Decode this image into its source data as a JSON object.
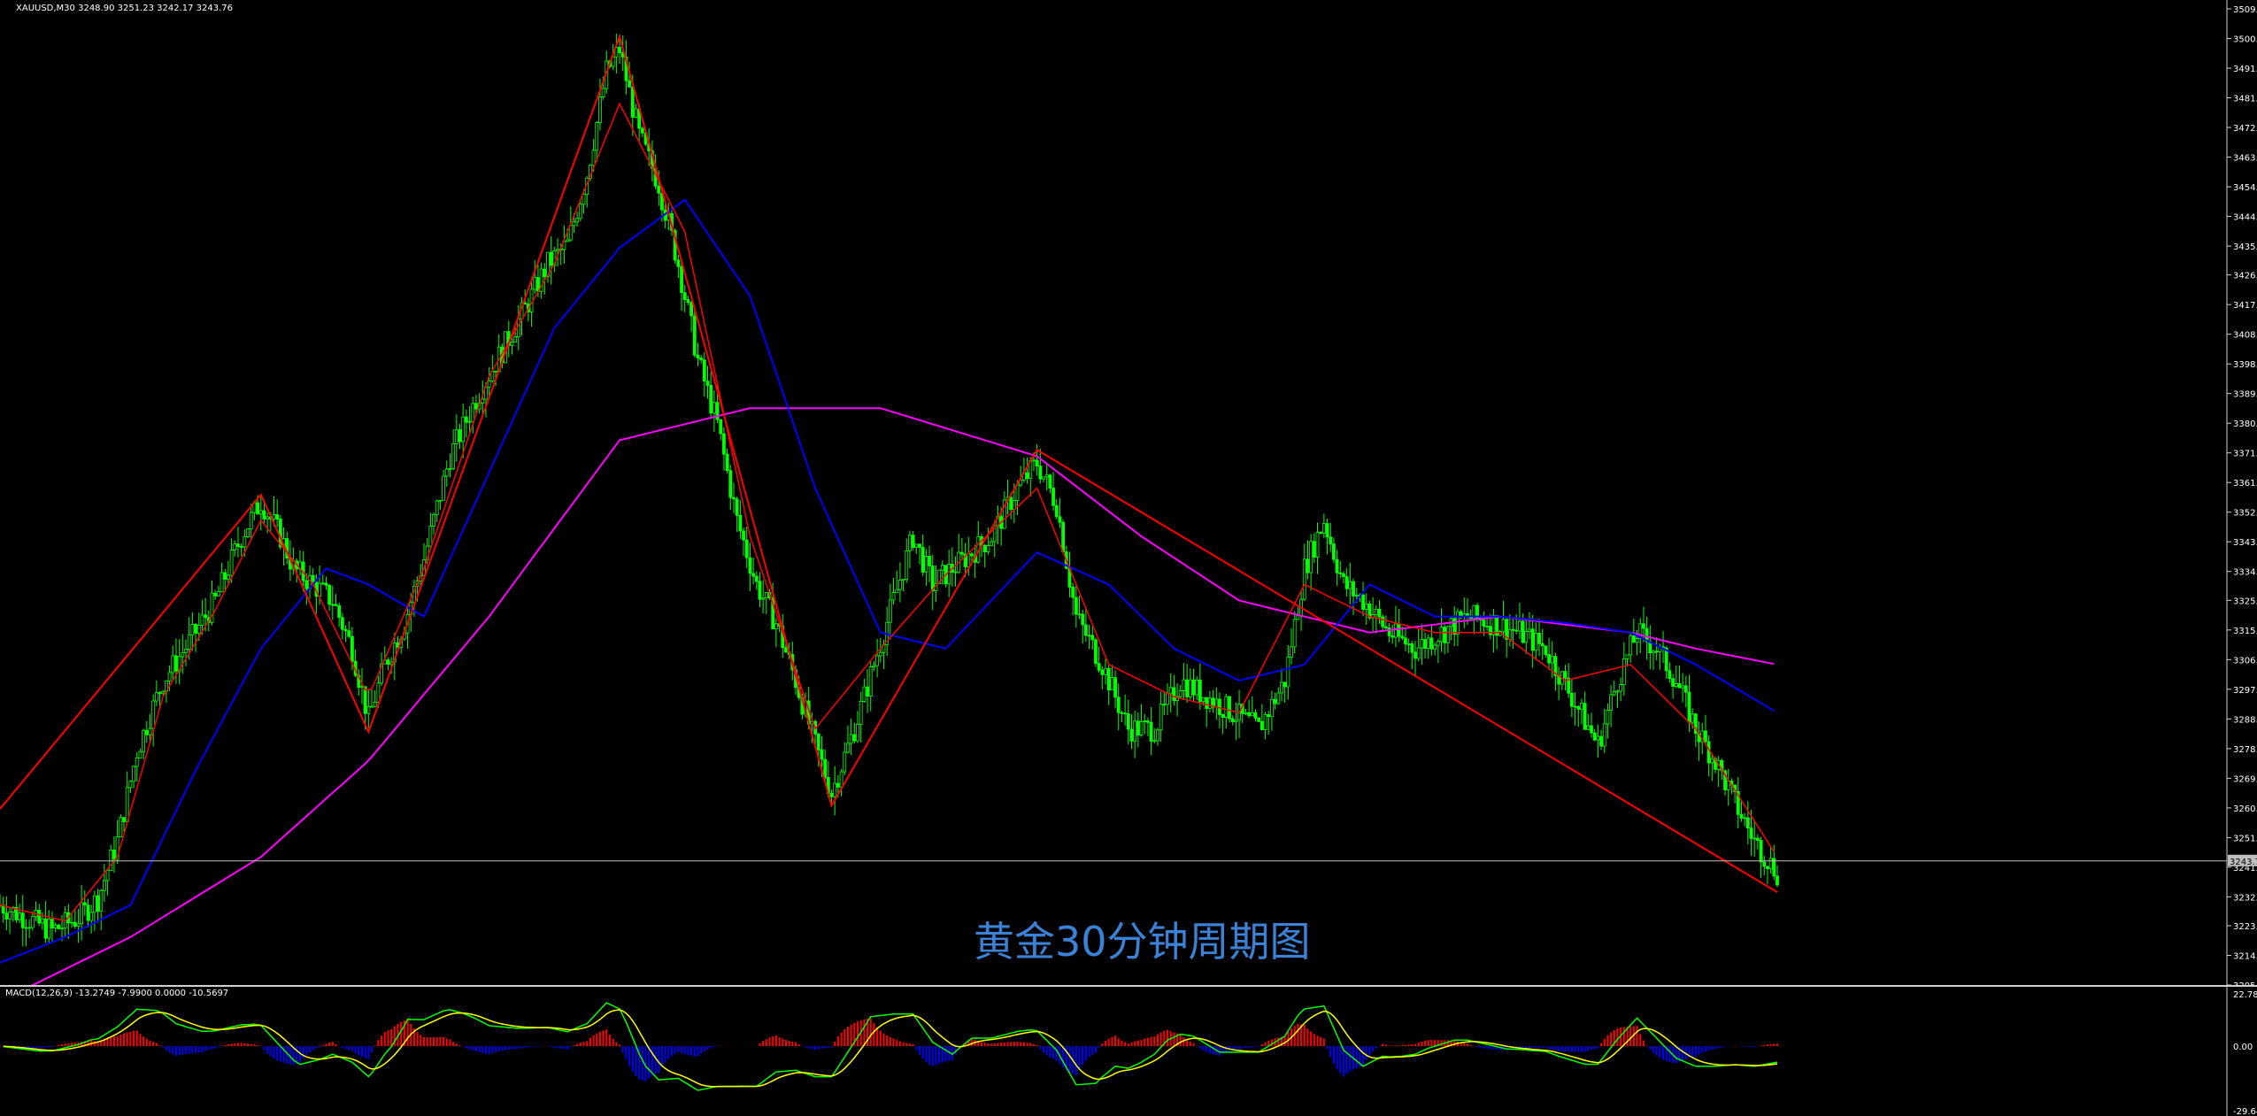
{
  "header": {
    "symbol_info": "XAUUSD,M30  3248.90 3251.23 3242.17 3243.76",
    "macd_info": "MACD(12,26,9) -13.2749 -7.9900 0.0000 -10.5697"
  },
  "watermark": "黄金30分钟周期图",
  "colors": {
    "background": "#000000",
    "bull_candle": "#00ff00",
    "bear_candle": "#00ff00",
    "ma_fast": "#ff0000",
    "ma_mid": "#0000ff",
    "ma_slow": "#ff00ff",
    "zigzag": "#ff0000",
    "macd_pos": "#ff0000",
    "macd_neg": "#0000ff",
    "macd_line": "#ffff00",
    "macd_signal": "#00ff00",
    "axis_text": "#ffffff",
    "watermark": "#3b82d6"
  },
  "chart_data": [
    {
      "type": "candlestick",
      "symbol": "XAUUSD",
      "timeframe": "M30",
      "ylim": [
        3205.05,
        3509.55
      ],
      "y_tick_labels": [
        "3509.55",
        "3500.30",
        "3491.05",
        "3481.80",
        "3472.55",
        "3463.30",
        "3454.05",
        "3444.80",
        "3435.55",
        "3426.55",
        "3417.30",
        "3408.05",
        "3398.80",
        "3389.55",
        "3380.30",
        "3371.05",
        "3361.80",
        "3352.55",
        "3343.30",
        "3334.05",
        "3325.05",
        "3315.80",
        "3306.55",
        "3297.30",
        "3288.05",
        "3278.80",
        "3269.55",
        "3260.30",
        "3251.05",
        "3241.80",
        "3232.55",
        "3223.55",
        "3214.30",
        "3205.05"
      ],
      "current_price": "3243.76",
      "zigzag_points": [
        {
          "bar": 0,
          "price": 3260
        },
        {
          "bar": 80,
          "price": 3358
        },
        {
          "bar": 113,
          "price": 3284
        },
        {
          "bar": 190,
          "price": 3501
        },
        {
          "bar": 255,
          "price": 3261
        },
        {
          "bar": 318,
          "price": 3372
        },
        {
          "bar": 545,
          "price": 3234
        }
      ],
      "price_path": [
        [
          0,
          3230
        ],
        [
          8,
          3226
        ],
        [
          16,
          3222
        ],
        [
          24,
          3226
        ],
        [
          30,
          3232
        ],
        [
          36,
          3250
        ],
        [
          42,
          3278
        ],
        [
          50,
          3300
        ],
        [
          58,
          3312
        ],
        [
          66,
          3325
        ],
        [
          74,
          3345
        ],
        [
          80,
          3356
        ],
        [
          86,
          3345
        ],
        [
          90,
          3335
        ],
        [
          96,
          3330
        ],
        [
          102,
          3325
        ],
        [
          108,
          3310
        ],
        [
          113,
          3288
        ],
        [
          118,
          3305
        ],
        [
          124,
          3318
        ],
        [
          130,
          3338
        ],
        [
          138,
          3370
        ],
        [
          146,
          3388
        ],
        [
          154,
          3403
        ],
        [
          162,
          3418
        ],
        [
          168,
          3430
        ],
        [
          174,
          3436
        ],
        [
          180,
          3458
        ],
        [
          186,
          3490
        ],
        [
          190,
          3497
        ],
        [
          196,
          3470
        ],
        [
          202,
          3455
        ],
        [
          208,
          3430
        ],
        [
          214,
          3400
        ],
        [
          220,
          3380
        ],
        [
          226,
          3350
        ],
        [
          232,
          3330
        ],
        [
          238,
          3318
        ],
        [
          244,
          3300
        ],
        [
          250,
          3280
        ],
        [
          255,
          3265
        ],
        [
          262,
          3285
        ],
        [
          268,
          3305
        ],
        [
          274,
          3325
        ],
        [
          280,
          3345
        ],
        [
          286,
          3330
        ],
        [
          292,
          3335
        ],
        [
          298,
          3340
        ],
        [
          304,
          3345
        ],
        [
          312,
          3360
        ],
        [
          318,
          3368
        ],
        [
          324,
          3355
        ],
        [
          330,
          3320
        ],
        [
          338,
          3305
        ],
        [
          346,
          3285
        ],
        [
          354,
          3285
        ],
        [
          362,
          3300
        ],
        [
          370,
          3295
        ],
        [
          378,
          3290
        ],
        [
          386,
          3285
        ],
        [
          394,
          3300
        ],
        [
          400,
          3335
        ],
        [
          406,
          3350
        ],
        [
          412,
          3330
        ],
        [
          418,
          3325
        ],
        [
          426,
          3315
        ],
        [
          434,
          3310
        ],
        [
          442,
          3315
        ],
        [
          450,
          3320
        ],
        [
          458,
          3318
        ],
        [
          466,
          3315
        ],
        [
          474,
          3310
        ],
        [
          482,
          3295
        ],
        [
          490,
          3280
        ],
        [
          496,
          3300
        ],
        [
          502,
          3315
        ],
        [
          508,
          3310
        ],
        [
          514,
          3300
        ],
        [
          520,
          3285
        ],
        [
          526,
          3275
        ],
        [
          532,
          3262
        ],
        [
          538,
          3250
        ],
        [
          545,
          3240
        ]
      ],
      "ma_fast_path": [
        [
          0,
          3230
        ],
        [
          20,
          3225
        ],
        [
          36,
          3245
        ],
        [
          50,
          3295
        ],
        [
          66,
          3322
        ],
        [
          80,
          3350
        ],
        [
          96,
          3330
        ],
        [
          113,
          3295
        ],
        [
          130,
          3335
        ],
        [
          150,
          3395
        ],
        [
          170,
          3430
        ],
        [
          190,
          3480
        ],
        [
          210,
          3440
        ],
        [
          230,
          3345
        ],
        [
          250,
          3285
        ],
        [
          270,
          3310
        ],
        [
          290,
          3333
        ],
        [
          318,
          3360
        ],
        [
          340,
          3305
        ],
        [
          360,
          3295
        ],
        [
          380,
          3290
        ],
        [
          400,
          3330
        ],
        [
          420,
          3320
        ],
        [
          440,
          3315
        ],
        [
          460,
          3315
        ],
        [
          480,
          3300
        ],
        [
          500,
          3305
        ],
        [
          520,
          3285
        ],
        [
          545,
          3245
        ]
      ],
      "ma_mid_path": [
        [
          0,
          3212
        ],
        [
          20,
          3220
        ],
        [
          40,
          3230
        ],
        [
          60,
          3272
        ],
        [
          80,
          3310
        ],
        [
          100,
          3335
        ],
        [
          113,
          3330
        ],
        [
          130,
          3320
        ],
        [
          150,
          3365
        ],
        [
          170,
          3410
        ],
        [
          190,
          3435
        ],
        [
          210,
          3450
        ],
        [
          230,
          3420
        ],
        [
          250,
          3360
        ],
        [
          270,
          3315
        ],
        [
          290,
          3310
        ],
        [
          318,
          3340
        ],
        [
          340,
          3330
        ],
        [
          360,
          3310
        ],
        [
          380,
          3300
        ],
        [
          400,
          3305
        ],
        [
          420,
          3330
        ],
        [
          440,
          3320
        ],
        [
          460,
          3320
        ],
        [
          480,
          3318
        ],
        [
          500,
          3315
        ],
        [
          520,
          3305
        ],
        [
          545,
          3290
        ]
      ],
      "ma_slow_path": [
        [
          0,
          3200
        ],
        [
          40,
          3220
        ],
        [
          80,
          3245
        ],
        [
          113,
          3275
        ],
        [
          150,
          3320
        ],
        [
          190,
          3375
        ],
        [
          230,
          3385
        ],
        [
          270,
          3385
        ],
        [
          318,
          3370
        ],
        [
          350,
          3345
        ],
        [
          380,
          3325
        ],
        [
          420,
          3315
        ],
        [
          460,
          3320
        ],
        [
          500,
          3315
        ],
        [
          520,
          3310
        ],
        [
          545,
          3305
        ]
      ]
    },
    {
      "type": "macd",
      "params": "12,26,9",
      "values": {
        "macd": -13.2749,
        "signal": -7.99,
        "zero": 0.0,
        "hist": -10.5697
      },
      "ylim": [
        -29.64,
        22.78
      ],
      "y_tick_labels": [
        "22.7833",
        "0.00",
        "-29.64"
      ]
    }
  ]
}
